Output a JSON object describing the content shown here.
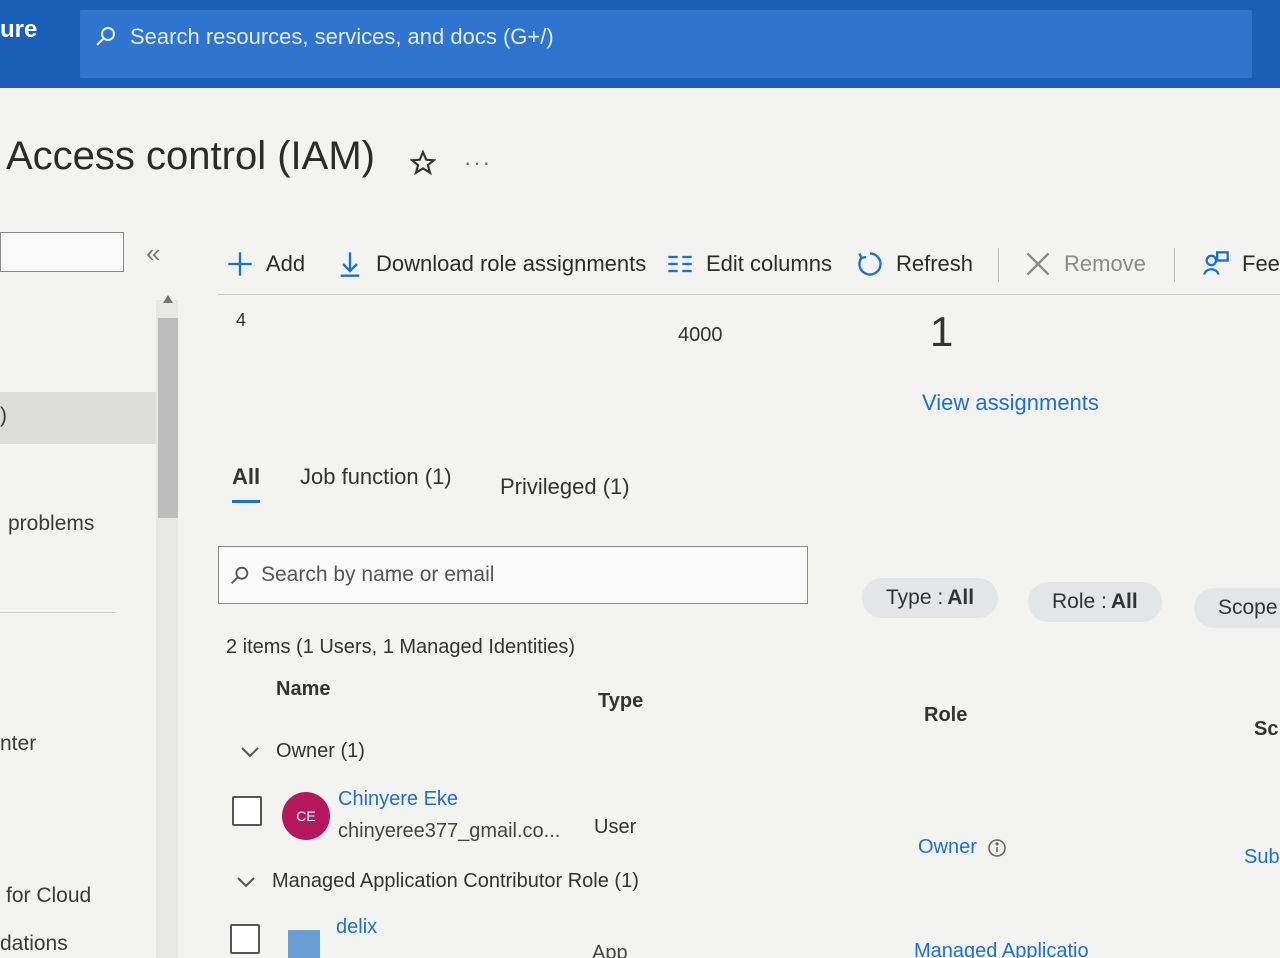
{
  "header": {
    "brand": "ure",
    "search_placeholder": "Search resources, services, and docs (G+/)"
  },
  "page": {
    "title": "Access control (IAM)",
    "more": "···"
  },
  "sidebar": {
    "items": [
      {
        "label": ")"
      },
      {
        "label": "problems"
      },
      {
        "label": "nter"
      },
      {
        "label": "for Cloud"
      },
      {
        "label": "dations"
      }
    ]
  },
  "toolbar": {
    "add": "Add",
    "download": "Download role assignments",
    "edit_columns": "Edit columns",
    "refresh": "Refresh",
    "remove": "Remove",
    "feedback": "Fee"
  },
  "stats": {
    "value_a": "4",
    "value_b": "4000",
    "value_c": "1",
    "view_assignments": "View assignments"
  },
  "tabs": [
    {
      "label": "All",
      "active": true
    },
    {
      "label": "Job function (1)",
      "active": false
    },
    {
      "label": "Privileged (1)",
      "active": false
    }
  ],
  "filter": {
    "search_placeholder": "Search by name or email",
    "type_label": "Type :",
    "type_value": "All",
    "role_label": "Role :",
    "role_value": "All",
    "scope_label": "Scope"
  },
  "summary": "2 items (1 Users, 1 Managed Identities)",
  "columns": {
    "name": "Name",
    "type": "Type",
    "role": "Role",
    "scope": "Sc"
  },
  "groups": [
    {
      "label": "Owner (1)",
      "rows": [
        {
          "initials": "CE",
          "name": "Chinyere Eke",
          "email": "chinyeree377_gmail.co...",
          "type": "User",
          "role": "Owner",
          "scope": "Sub"
        }
      ]
    },
    {
      "label": "Managed Application Contributor Role (1)",
      "rows": [
        {
          "name": "delix",
          "type": "App",
          "role": "Managed Applicatio"
        }
      ]
    }
  ],
  "colors": {
    "topbar": "#1b5fb8",
    "link": "#1f6fce",
    "avatar": "#b5175f"
  }
}
